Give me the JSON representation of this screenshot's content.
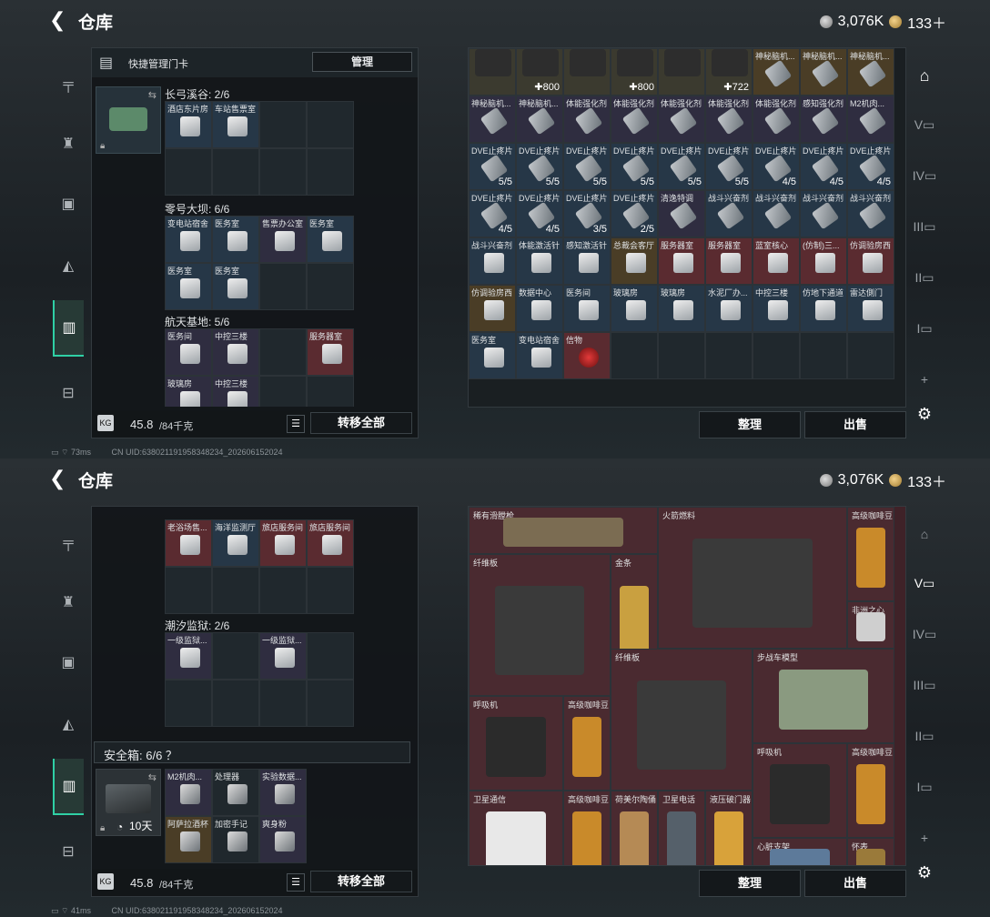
{
  "screens": [
    {
      "header": {
        "title": "仓库",
        "currency": "3,076K",
        "premium": "133＋"
      },
      "quick": {
        "title": "快捷管理门卡",
        "manage": "管理"
      },
      "groups": [
        {
          "name": "长弓溪谷: 2/6",
          "items": [
            "酒店东片房",
            "车站售票室"
          ]
        },
        {
          "name": "零号大坝: 6/6",
          "items": [
            "变电站宿舍",
            "医务室",
            "售票办公室",
            "医务室",
            "医务室",
            "医务室"
          ]
        },
        {
          "name": "航天基地: 5/6",
          "items": [
            "医务间",
            "中控三楼",
            "",
            "服务器室",
            "玻璃房",
            "中控三楼"
          ]
        }
      ],
      "weight": {
        "current": "45.8",
        "max": "/84千克"
      },
      "transfer_all": "转移全部",
      "grid": [
        [
          "",
          "",
          "",
          "",
          "",
          "",
          "神秘脑机...",
          "神秘脑机...",
          "神秘脑机..."
        ],
        [
          "神秘脑机...",
          "神秘脑机...",
          "体能强化剂",
          "体能强化剂",
          "体能强化剂",
          "体能强化剂",
          "体能强化剂",
          "感知强化剂",
          "M2机肉..."
        ],
        [
          "DVE止疼片",
          "DVE止疼片",
          "DVE止疼片",
          "DVE止疼片",
          "DVE止疼片",
          "DVE止疼片",
          "DVE止疼片",
          "DVE止疼片",
          "DVE止疼片"
        ],
        [
          "DVE止疼片",
          "DVE止疼片",
          "DVE止疼片",
          "DVE止疼片",
          "清逸特调",
          "战斗兴奋剂",
          "战斗兴奋剂",
          "战斗兴奋剂",
          "战斗兴奋剂"
        ],
        [
          "战斗兴奋剂",
          "体能激活针",
          "感知激活针",
          "总裁会客厅",
          "服务器室",
          "服务器室",
          "蓝室核心",
          "(仿制)三...",
          "仿调验房西"
        ],
        [
          "仿调验房西",
          "数据中心",
          "医务间",
          "玻璃房",
          "玻璃房",
          "水泥厂办...",
          "中控三楼",
          "仿地下通道",
          "雷达側门"
        ],
        [
          "医务室",
          "变电站宿舍",
          "信物",
          "",
          "",
          "",
          "",
          "",
          ""
        ]
      ],
      "counts": {
        "r0": [
          "✚800",
          "✚800",
          "✚722"
        ],
        "r2": [
          "5/5",
          "5/5",
          "5/5",
          "5/5",
          "5/5",
          "5/5",
          "4/5",
          "4/5",
          "4/5"
        ],
        "r3": [
          "4/5",
          "4/5",
          "3/5",
          "2/5"
        ]
      },
      "sort": "整理",
      "sell": "出售",
      "status": {
        "ping": "73ms",
        "uid": "CN UID:6380211919583482​34_202606152024"
      }
    },
    {
      "header": {
        "title": "仓库",
        "currency": "3,076K",
        "premium": "133＋"
      },
      "groups": [
        {
          "name": "",
          "items": [
            "老浴场售...",
            "海洋监测厅",
            "旅店服务间",
            "旅店服务间"
          ]
        },
        {
          "name": "潮汐监狱: 2/6",
          "items": [
            "一级监狱...",
            "",
            "一级监狱...",
            ""
          ]
        }
      ],
      "safe": {
        "label": "安全箱: 6/6 ？",
        "timer": "10天",
        "items": [
          "M2机肉...",
          "处理器",
          "实验数据...",
          "阿萨拉酒杯",
          "加密手记",
          "爽身粉"
        ]
      },
      "weight": {
        "current": "45.8",
        "max": "/84千克"
      },
      "transfer_all": "转移全部",
      "big_items": [
        "稀有滑膛枪",
        "火箭燃料",
        "高级咖啡豆",
        "纤维板",
        "金条",
        "非洲之心",
        "纤维板",
        "步战车模型",
        "呼吸机",
        "高级咖啡豆",
        "呼吸机",
        "高级咖啡豆",
        "卫星通信",
        "高级咖啡豆",
        "荷美尔陶俑",
        "卫星电话",
        "液压破门器",
        "心脏支架",
        "怀表"
      ],
      "sort": "整理",
      "sell": "出售",
      "status": {
        "ping": "41ms",
        "uid": "CN UID:638021191958348234_202606152024"
      }
    }
  ]
}
